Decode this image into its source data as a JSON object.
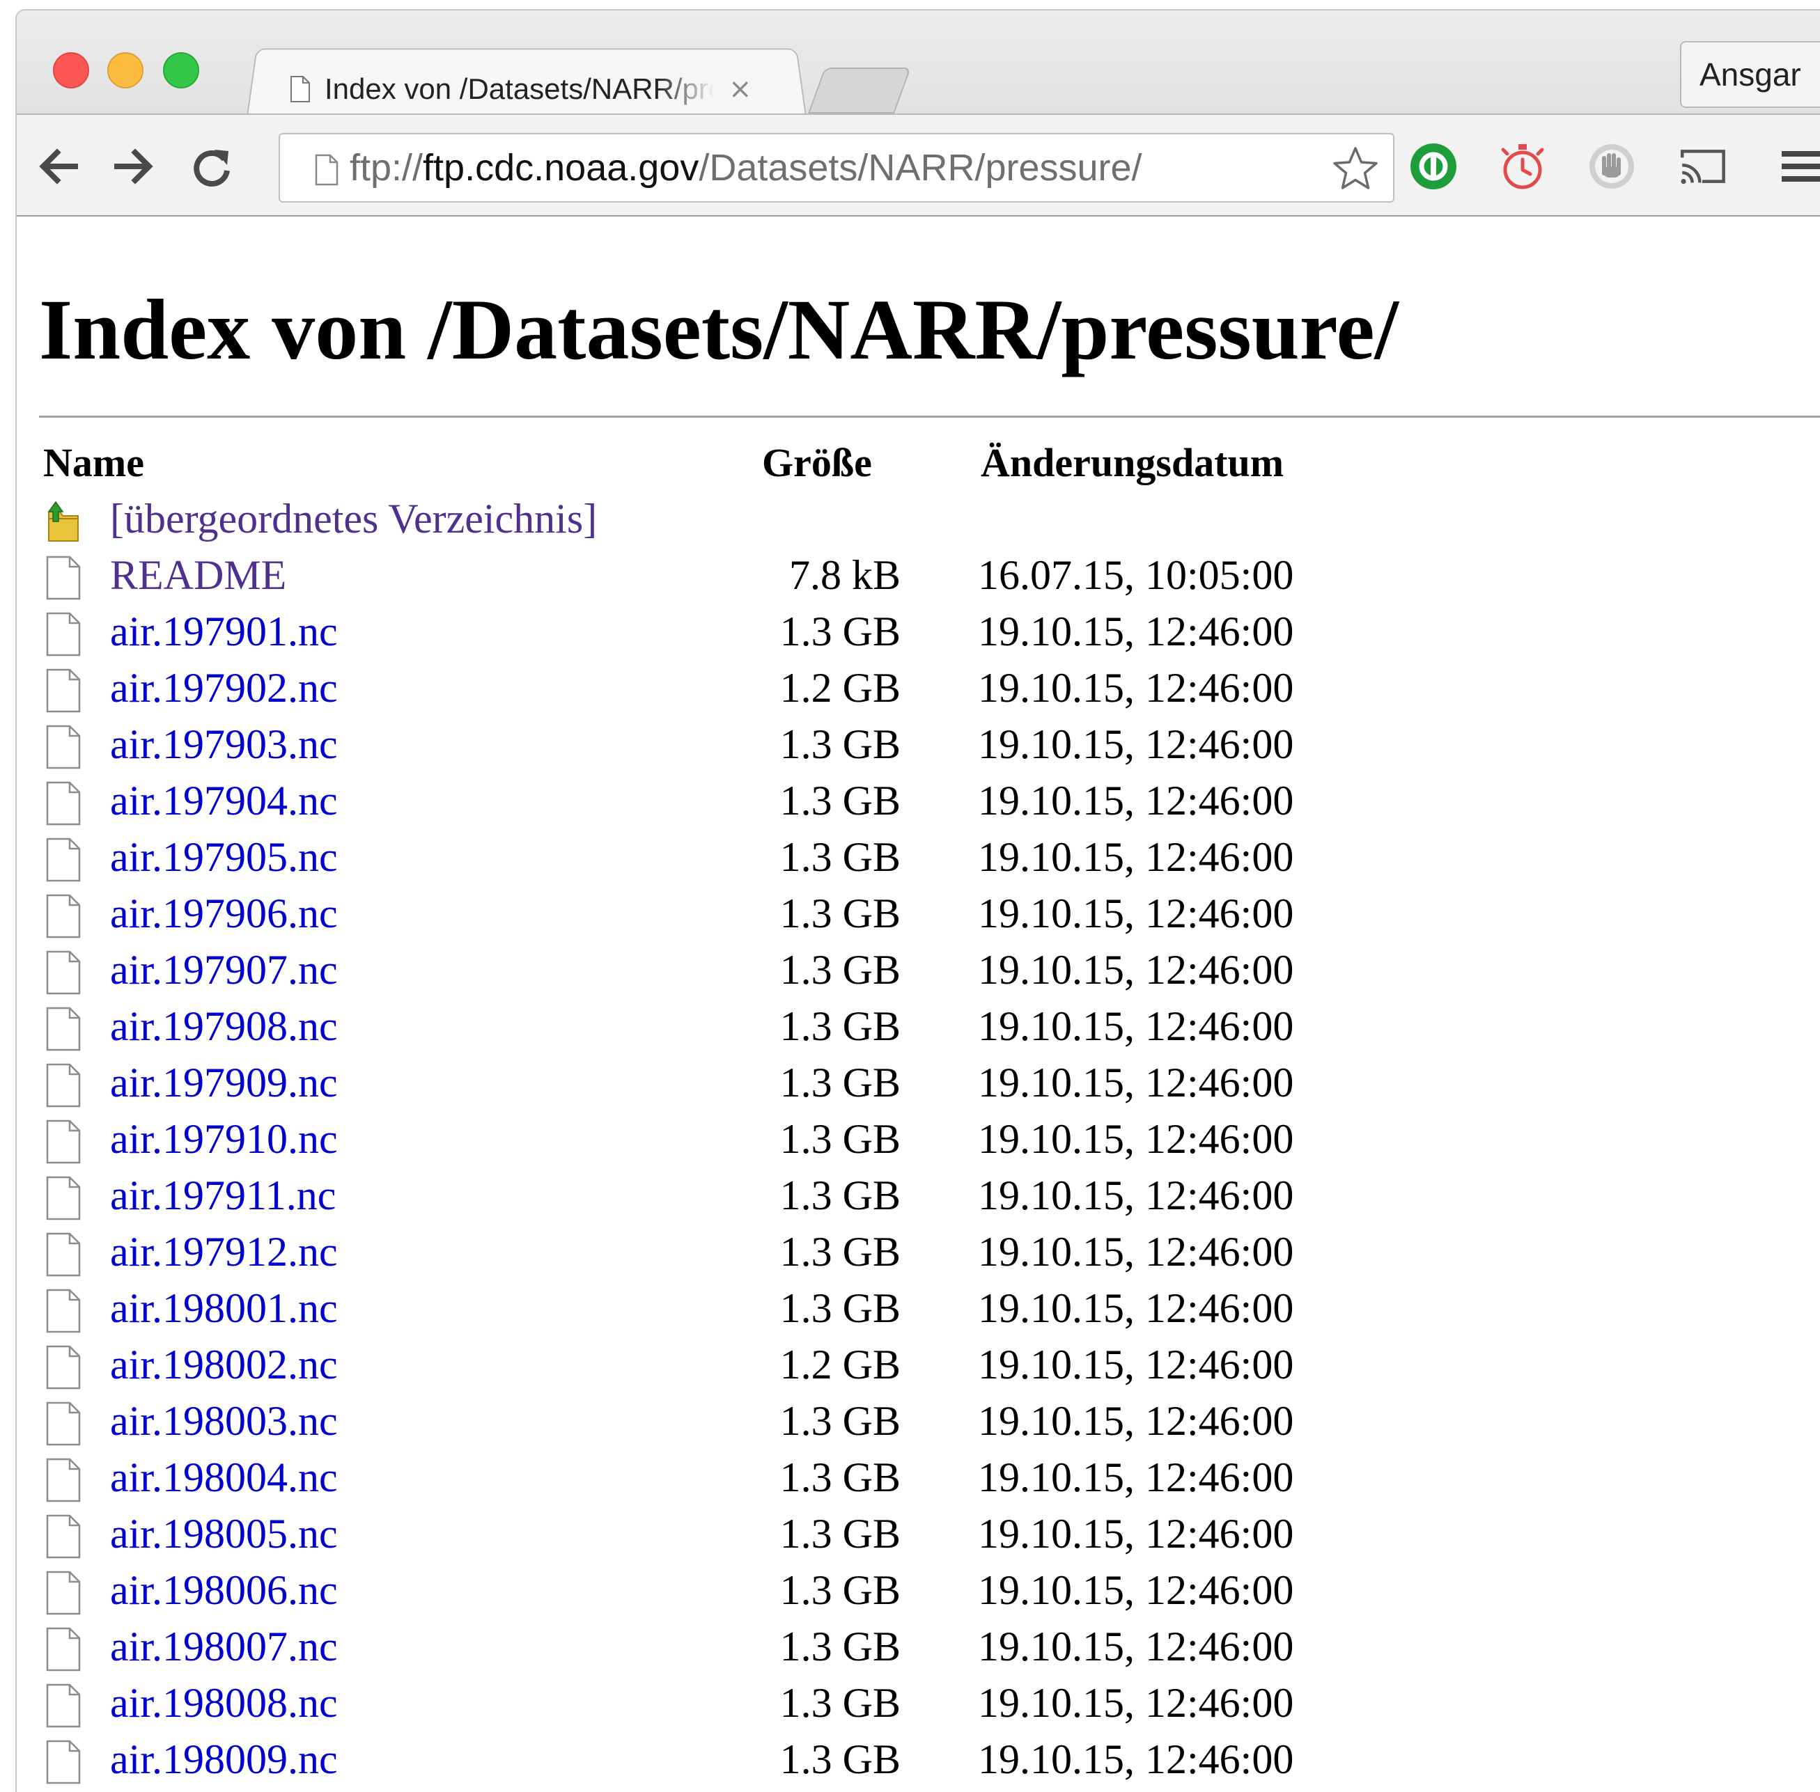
{
  "tab": {
    "title": "Index von /Datasets/NARR/pressure/",
    "close_glyph": "×"
  },
  "profile": {
    "name": "Ansgar"
  },
  "omnibox": {
    "scheme": "ftp://",
    "host": "ftp.cdc.noaa.gov",
    "path": "/Datasets/NARR/pressure/"
  },
  "extensions": [
    "green-circle-icon",
    "red-timer-icon",
    "grey-hand-icon",
    "cast-icon",
    "menu-icon"
  ],
  "colors": {
    "link": "#0000d0",
    "visited_link": "#50308f",
    "extension_green": "#1e9e3b",
    "extension_red": "#e24b4b"
  },
  "page": {
    "heading": "Index von /Datasets/NARR/pressure/",
    "columns": {
      "name": "Name",
      "size": "Größe",
      "date": "Änderungsdatum"
    },
    "parent": {
      "name": "[übergeordnetes Verzeichnis]",
      "size": "",
      "date": ""
    },
    "files": [
      {
        "name": "README",
        "size": "7.8 kB",
        "date": "16.07.15, 10:05:00"
      },
      {
        "name": "air.197901.nc",
        "size": "1.3 GB",
        "date": "19.10.15, 12:46:00"
      },
      {
        "name": "air.197902.nc",
        "size": "1.2 GB",
        "date": "19.10.15, 12:46:00"
      },
      {
        "name": "air.197903.nc",
        "size": "1.3 GB",
        "date": "19.10.15, 12:46:00"
      },
      {
        "name": "air.197904.nc",
        "size": "1.3 GB",
        "date": "19.10.15, 12:46:00"
      },
      {
        "name": "air.197905.nc",
        "size": "1.3 GB",
        "date": "19.10.15, 12:46:00"
      },
      {
        "name": "air.197906.nc",
        "size": "1.3 GB",
        "date": "19.10.15, 12:46:00"
      },
      {
        "name": "air.197907.nc",
        "size": "1.3 GB",
        "date": "19.10.15, 12:46:00"
      },
      {
        "name": "air.197908.nc",
        "size": "1.3 GB",
        "date": "19.10.15, 12:46:00"
      },
      {
        "name": "air.197909.nc",
        "size": "1.3 GB",
        "date": "19.10.15, 12:46:00"
      },
      {
        "name": "air.197910.nc",
        "size": "1.3 GB",
        "date": "19.10.15, 12:46:00"
      },
      {
        "name": "air.197911.nc",
        "size": "1.3 GB",
        "date": "19.10.15, 12:46:00"
      },
      {
        "name": "air.197912.nc",
        "size": "1.3 GB",
        "date": "19.10.15, 12:46:00"
      },
      {
        "name": "air.198001.nc",
        "size": "1.3 GB",
        "date": "19.10.15, 12:46:00"
      },
      {
        "name": "air.198002.nc",
        "size": "1.2 GB",
        "date": "19.10.15, 12:46:00"
      },
      {
        "name": "air.198003.nc",
        "size": "1.3 GB",
        "date": "19.10.15, 12:46:00"
      },
      {
        "name": "air.198004.nc",
        "size": "1.3 GB",
        "date": "19.10.15, 12:46:00"
      },
      {
        "name": "air.198005.nc",
        "size": "1.3 GB",
        "date": "19.10.15, 12:46:00"
      },
      {
        "name": "air.198006.nc",
        "size": "1.3 GB",
        "date": "19.10.15, 12:46:00"
      },
      {
        "name": "air.198007.nc",
        "size": "1.3 GB",
        "date": "19.10.15, 12:46:00"
      },
      {
        "name": "air.198008.nc",
        "size": "1.3 GB",
        "date": "19.10.15, 12:46:00"
      },
      {
        "name": "air.198009.nc",
        "size": "1.3 GB",
        "date": "19.10.15, 12:46:00"
      }
    ]
  }
}
